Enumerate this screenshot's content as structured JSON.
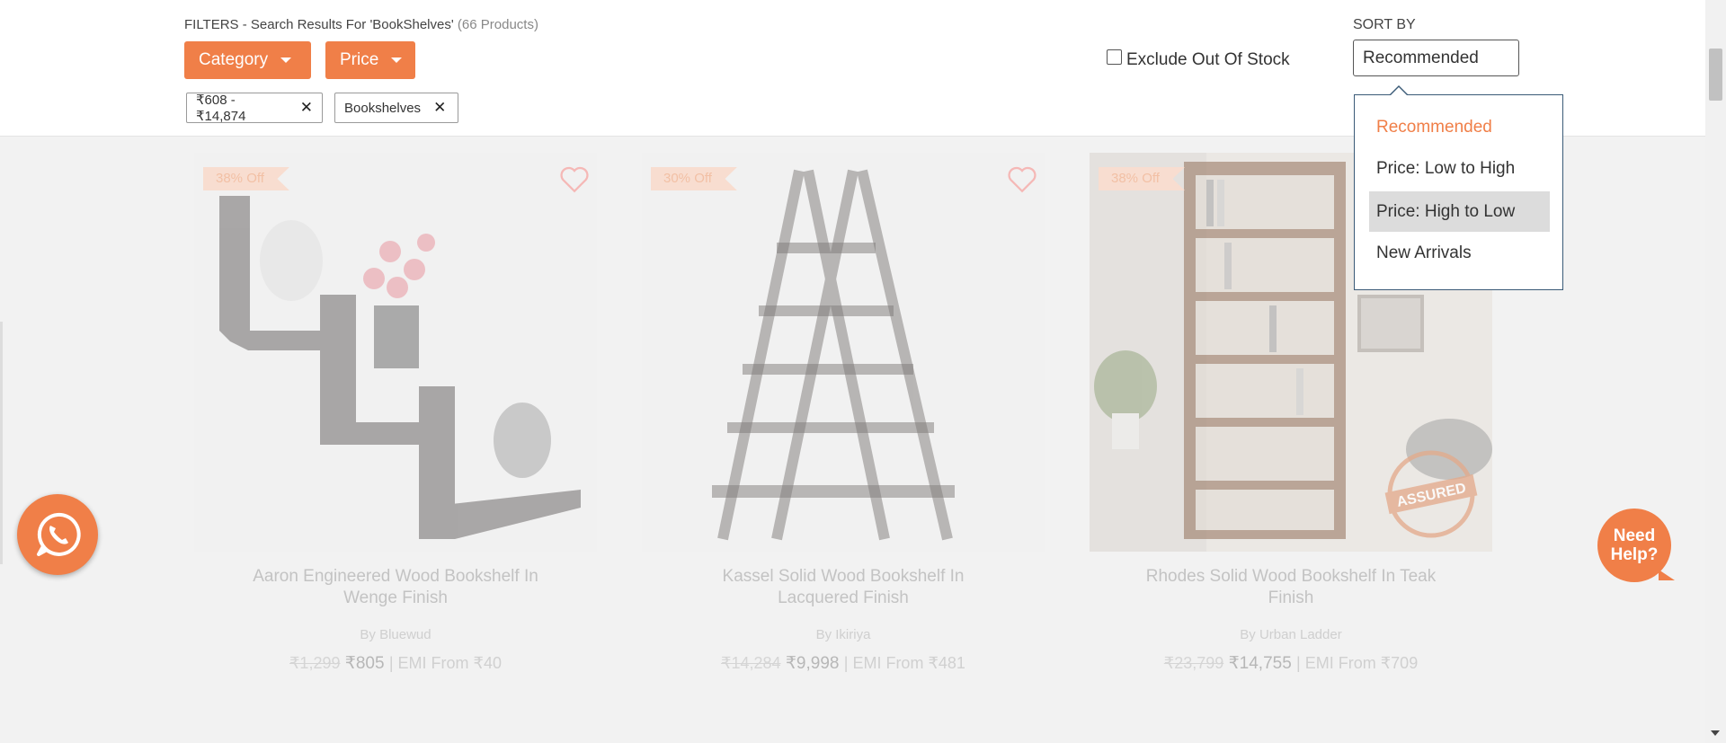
{
  "filters": {
    "title_prefix": "FILTERS - Search Results For 'BookShelves'",
    "title_count": "(66 Products)",
    "category_label": "Category",
    "price_label": "Price",
    "chips": [
      "₹608 - ₹14,874",
      "Bookshelves"
    ]
  },
  "exclude_out_of_stock": {
    "label": "Exclude Out Of Stock",
    "checked": false
  },
  "sort": {
    "label": "SORT BY",
    "selected": "Recommended",
    "options": [
      "Recommended",
      "Price: Low to High",
      "Price: High to Low",
      "New Arrivals"
    ],
    "active_option": "Recommended",
    "hovered_option": "Price: High to Low"
  },
  "products": [
    {
      "discount": "38% Off",
      "title": "Aaron Engineered Wood Bookshelf In Wenge Finish",
      "brand": "By Bluewud",
      "old_price": "₹1,299",
      "new_price": "₹805",
      "emi": "| EMI From ₹40",
      "assured": false
    },
    {
      "discount": "30% Off",
      "title": "Kassel Solid Wood Bookshelf In Lacquered Finish",
      "brand": "By Ikiriya",
      "old_price": "₹14,284",
      "new_price": "₹9,998",
      "emi": "| EMI From ₹481",
      "assured": false
    },
    {
      "discount": "38% Off",
      "title": "Rhodes Solid Wood Bookshelf In Teak Finish",
      "brand": "By Urban Ladder",
      "old_price": "₹23,799",
      "new_price": "₹14,755",
      "emi": "| EMI From ₹709",
      "assured": true
    }
  ],
  "help": {
    "line1": "Need",
    "line2": "Help?"
  },
  "colors": {
    "accent": "#f07f48",
    "dropdown_border": "#3a5a77",
    "hover_bg": "#dcdcdc"
  },
  "icons": [
    "caret-down-icon",
    "close-icon",
    "heart-icon",
    "whatsapp-icon",
    "scroll-down-icon"
  ]
}
